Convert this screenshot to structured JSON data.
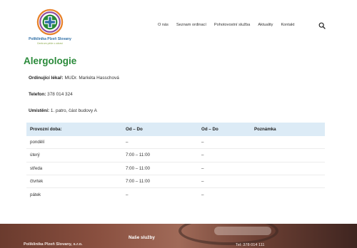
{
  "brand": {
    "name": "Poliklinika Plzeň Slovany",
    "tagline": "Centrum péče o zdraví",
    "colors": {
      "green": "#2a8a3a",
      "blue": "#2f6fa6",
      "orange": "#e8822a",
      "purple": "#8b4aa0"
    }
  },
  "nav": {
    "items": [
      "O nás",
      "Seznam ordinací",
      "Pohotovostní služba",
      "Aktuality",
      "Kontakt"
    ],
    "search_icon": "search-icon"
  },
  "page": {
    "title": "Alergologie",
    "doctor_label": "Ordinující lékař:",
    "doctor_value": "MUDr. Markéta Hasschová",
    "phone_label": "Telefon:",
    "phone_value": "378 014 324",
    "location_label": "Umístění:",
    "location_value": "1. patro, část budovy A"
  },
  "hours_table": {
    "headers": [
      "Provozní doba:",
      "Od – Do",
      "Od – Do",
      "Poznámka"
    ],
    "rows": [
      [
        "pondělí",
        "–",
        "–",
        ""
      ],
      [
        "úterý",
        "7:00 – 11:00",
        "–",
        ""
      ],
      [
        "středa",
        "7:00 – 11:00",
        "–",
        ""
      ],
      [
        "čtvrtek",
        "7:00 – 11:00",
        "–",
        ""
      ],
      [
        "pátek",
        "–",
        "–",
        ""
      ]
    ]
  },
  "footer": {
    "heading": "Naše služby",
    "company": "Poliklinika Plzeň Slovany, s.r.o.",
    "tel": "Tel: 378 014 111"
  }
}
